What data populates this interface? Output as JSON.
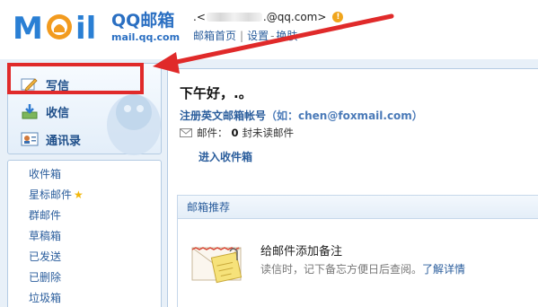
{
  "header": {
    "logo_text": "MOil",
    "brand": "QQ邮箱",
    "brand_url": "mail.qq.com",
    "account_prefix": ".<",
    "account_suffix": ".@qq.com>",
    "links": [
      "邮箱首页",
      "设置",
      "换肤"
    ],
    "separators": [
      "|",
      "-"
    ]
  },
  "sidebar": {
    "actions": [
      {
        "label": "写信",
        "icon": "pen-icon"
      },
      {
        "label": "收信",
        "icon": "inbox-download-icon"
      },
      {
        "label": "通讯录",
        "icon": "contacts-icon"
      }
    ],
    "folders": [
      {
        "label": "收件箱"
      },
      {
        "label": "星标邮件",
        "starred": true
      },
      {
        "label": "群邮件"
      },
      {
        "label": "草稿箱"
      },
      {
        "label": "已发送"
      },
      {
        "label": "已删除"
      },
      {
        "label": "垃圾箱"
      }
    ]
  },
  "main": {
    "greeting": "下午好，.。",
    "register": "注册英文邮箱帐号",
    "register_hint": "（如：chen@foxmail.com）",
    "mail_label": "邮件：",
    "unread_count": "0",
    "unread_text": "封未读邮件",
    "inbox_link": "进入收件箱",
    "recommend": {
      "title": "邮箱推荐",
      "item_title": "给邮件添加备注",
      "item_desc": "读信时，记下备忘方便日后查阅。",
      "item_more": "了解详情"
    }
  },
  "colors": {
    "brand_blue": "#2a6fc2",
    "link_blue": "#2a5d9c",
    "highlight_red": "#e02a2a",
    "warning_orange": "#f0a51c"
  }
}
